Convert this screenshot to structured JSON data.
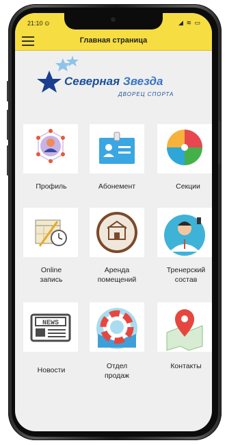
{
  "status": {
    "time": "21:10 ⊙",
    "icons": "◢ ≋ ▭"
  },
  "appbar": {
    "title": "Главная страница"
  },
  "logo": {
    "name_part1": "Северная ",
    "name_part2": "Звезда",
    "subtitle": "ДВОРЕЦ СПОРТА"
  },
  "menu": {
    "items": [
      {
        "label": "Профиль",
        "icon": "profile-icon"
      },
      {
        "label": "Абонемент",
        "icon": "id-card-icon"
      },
      {
        "label": "Секции",
        "icon": "sections-icon"
      },
      {
        "label": "Online\nзапись",
        "icon": "calendar-icon"
      },
      {
        "label": "Аренда\nпомещений",
        "icon": "building-rent-icon"
      },
      {
        "label": "Тренерский\nсостав",
        "icon": "coach-icon"
      },
      {
        "label": "Новости",
        "icon": "news-icon"
      },
      {
        "label": "Отдел\nпродаж",
        "icon": "lifebuoy-icon"
      },
      {
        "label": "Контакты",
        "icon": "map-pin-icon"
      }
    ]
  },
  "colors": {
    "accent": "#f6dd41",
    "brand": "#1b4f9c"
  }
}
